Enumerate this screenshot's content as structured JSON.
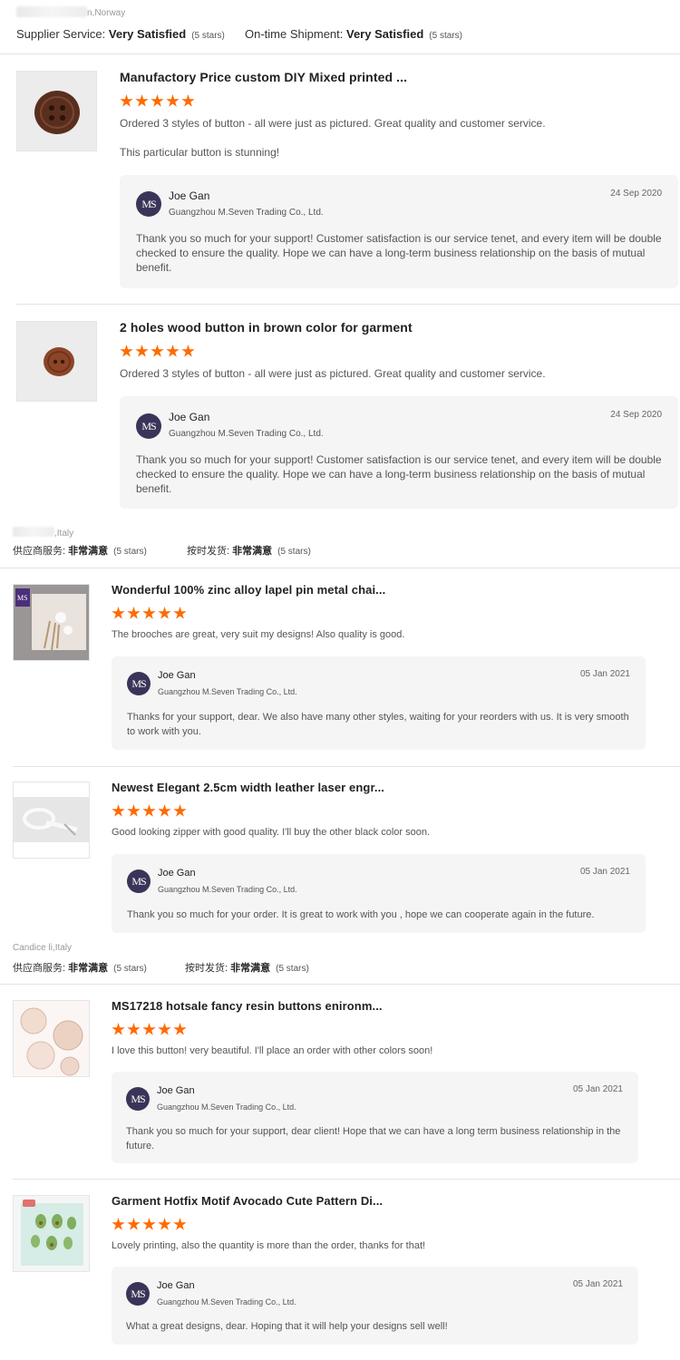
{
  "colors": {
    "star": "#ff6a00",
    "reply_bg": "#f5f5f5",
    "separator": "#e3e3e3",
    "logo_bg": "#3a3558"
  },
  "groups": [
    {
      "country": "n,Norway",
      "supplier_label": "Supplier Service:",
      "supplier_value": "Very Satisfied",
      "supplier_stars": "(5 stars)",
      "shipment_label": "On-time Shipment:",
      "shipment_value": "Very Satisfied",
      "shipment_stars": "(5 stars)"
    },
    {
      "country": ",Italy",
      "supplier_label": "供应商服务:",
      "supplier_value": "非常满意",
      "supplier_stars": "(5 stars)",
      "shipment_label": "按时发货:",
      "shipment_value": "非常满意",
      "shipment_stars": "(5 stars)"
    },
    {
      "country": "Candice li,Italy",
      "supplier_label": "供应商服务:",
      "supplier_value": "非常满意",
      "supplier_stars": "(5 stars)",
      "shipment_label": "按时发货:",
      "shipment_value": "非常满意",
      "shipment_stars": "(5 stars)"
    }
  ],
  "reviews": [
    {
      "title": "Manufactory Price custom DIY Mixed printed ...",
      "rating": 5,
      "text": "Ordered 3 styles of button - all were just as pictured. Great quality and customer service.",
      "text2": "This particular button is stunning!",
      "reply": {
        "logo": "MS",
        "name": "Joe Gan",
        "company": "Guangzhou M.Seven Trading Co., Ltd.",
        "date": "24 Sep 2020",
        "body": "Thank you so much for your support!  Customer satisfaction is our service tenet,  and every item will be double checked to ensure the quality. Hope we can have a long-term business relationship on the basis of mutual benefit."
      }
    },
    {
      "title": "2 holes wood button in brown color for garment",
      "rating": 5,
      "text": "Ordered 3 styles of button - all were just as pictured. Great quality and customer service.",
      "reply": {
        "logo": "MS",
        "name": "Joe Gan",
        "company": "Guangzhou M.Seven Trading Co., Ltd.",
        "date": "24 Sep 2020",
        "body": "Thank you so much for your support!  Customer satisfaction is our service tenet,  and every item will be double checked to ensure the quality. Hope we can have a long-term business relationship on the basis of mutual benefit."
      }
    },
    {
      "title": "Wonderful 100% zinc alloy lapel pin metal chai...",
      "rating": 5,
      "text": "The brooches are great, very suit my designs! Also quality is good.",
      "reply": {
        "logo": "MS",
        "name": "Joe Gan",
        "company": "Guangzhou M.Seven Trading Co., Ltd.",
        "date": "05 Jan 2021",
        "body": "Thanks for your support, dear. We also have many other styles, waiting for your reorders with us. It is very smooth to work with you."
      }
    },
    {
      "title": "Newest Elegant 2.5cm width leather laser engr...",
      "rating": 5,
      "text": "Good looking zipper with good quality. I'll buy the other black color soon.",
      "reply": {
        "logo": "MS",
        "name": "Joe Gan",
        "company": "Guangzhou M.Seven Trading Co., Ltd.",
        "date": "05 Jan 2021",
        "body": "Thank you so much for your order. It is great to work with you , hope we can cooperate again in the future."
      }
    },
    {
      "title": "MS17218 hotsale fancy resin buttons enironm...",
      "rating": 5,
      "text": "I love this button! very beautiful. I'll place an order with other colors soon!",
      "reply": {
        "logo": "MS",
        "name": "Joe Gan",
        "company": "Guangzhou M.Seven Trading Co., Ltd.",
        "date": "05 Jan 2021",
        "body": "Thank you so much for your support, dear client! Hope that we can have a long term business relationship in the future."
      }
    },
    {
      "title": "Garment Hotfix Motif Avocado Cute Pattern Di...",
      "rating": 5,
      "text": "Lovely printing, also the quantity is more than the order, thanks for that!",
      "reply": {
        "logo": "MS",
        "name": "Joe Gan",
        "company": "Guangzhou M.Seven Trading Co., Ltd.",
        "date": "05 Jan 2021",
        "body": "What a great designs, dear. Hoping that it will help your designs sell well!"
      }
    }
  ]
}
